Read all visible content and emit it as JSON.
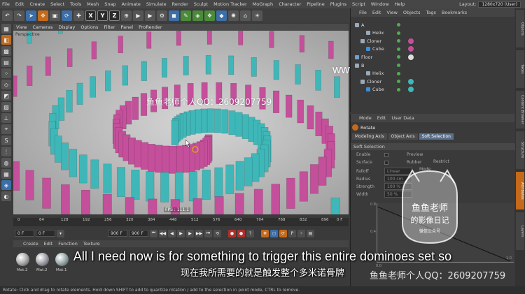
{
  "menubar": [
    "File",
    "Edit",
    "Create",
    "Select",
    "Tools",
    "Mesh",
    "Snap",
    "Animate",
    "Simulate",
    "Render",
    "Sculpt",
    "Motion Tracker",
    "MoGraph",
    "Character",
    "Pipeline",
    "Plugins",
    "Script",
    "Window",
    "Help"
  ],
  "layout": {
    "label": "Layout:",
    "value": "1280x720 (User)"
  },
  "toolbar_axes": [
    "X",
    "Y",
    "Z"
  ],
  "viewport": {
    "menu": [
      "View",
      "Cameras",
      "Display",
      "Options",
      "Filter",
      "Panel",
      "ProRender"
    ],
    "camera_label": "Perspective",
    "fps": "FPS : 111.1"
  },
  "ruler_ticks": [
    "0",
    "64",
    "128",
    "192",
    "256",
    "320",
    "384",
    "448",
    "512",
    "576",
    "640",
    "704",
    "768",
    "832",
    "896"
  ],
  "ruler_end": "0 F",
  "transport": {
    "current": "0 F",
    "start": "0 F",
    "end": "900 F",
    "max": "900 F"
  },
  "materials": {
    "menu": [
      "Create",
      "Edit",
      "Function",
      "Texture"
    ],
    "items": [
      "Mat.2",
      "Mat.2",
      "Mat.1"
    ]
  },
  "status": "Rotate: Click and drag to rotate elements. Hold down SHIFT to add to quantize rotation / add to the selection in point mode, CTRL to remove.",
  "objects": {
    "menu": [
      "File",
      "Edit",
      "View",
      "Objects",
      "Tags",
      "Bookmarks"
    ],
    "rows": [
      {
        "name": "A",
        "indent": 0
      },
      {
        "name": "Helix",
        "indent": 2
      },
      {
        "name": "Cloner",
        "indent": 1
      },
      {
        "name": "Cube",
        "indent": 2
      },
      {
        "name": "Floor",
        "indent": 0
      },
      {
        "name": "B",
        "indent": 0
      },
      {
        "name": "Helix",
        "indent": 2
      },
      {
        "name": "Cloner",
        "indent": 1
      },
      {
        "name": "Cube",
        "indent": 2
      }
    ]
  },
  "attributes": {
    "menu": [
      "Mode",
      "Edit",
      "User Data"
    ],
    "title": "Rotate",
    "tabs": [
      "Modeling Axis",
      "Object Axis",
      "Soft Selection"
    ],
    "section": "Soft Selection",
    "rows": [
      {
        "label": "Enable",
        "extra": "Preview"
      },
      {
        "label": "Surface",
        "extra": "Rubber"
      },
      {
        "label": "Falloff",
        "value": "Linear"
      },
      {
        "label": "Radius",
        "value": "100 cm"
      },
      {
        "label": "Strength",
        "value": "100 %"
      },
      {
        "label": "Width",
        "value": "50 %"
      }
    ],
    "restrict_label": "Restrict",
    "mode_label": "Mode",
    "graph_x_label": "1.0",
    "graph_y_label": "0.8",
    "graph_y_label_2": "0.4",
    "graph_x_label_2": "0.0"
  },
  "dock_tabs": [
    "Objects",
    "Takes",
    "Content Browser",
    "Structure",
    "Attributes",
    "Layers"
  ],
  "watermark_left": "鱼鱼老师个人QQ：2609207759",
  "watermark_url": "www.yuyulaoshi.com",
  "watermark_bottom": "鱼鱼老师个人QQ：2609207759",
  "stamp": {
    "line1": "鱼鱼老师",
    "line2": "的影像日记",
    "line3": "微信公众号"
  },
  "subtitles": {
    "en": "All I need now is for something to trigger this entire dominoes set so",
    "zh": "现在我所需要的就是触发整个多米诺骨牌"
  },
  "colors": {
    "pink": "#c44f9a",
    "teal": "#3fb7b8",
    "accent": "#c46a1a"
  }
}
